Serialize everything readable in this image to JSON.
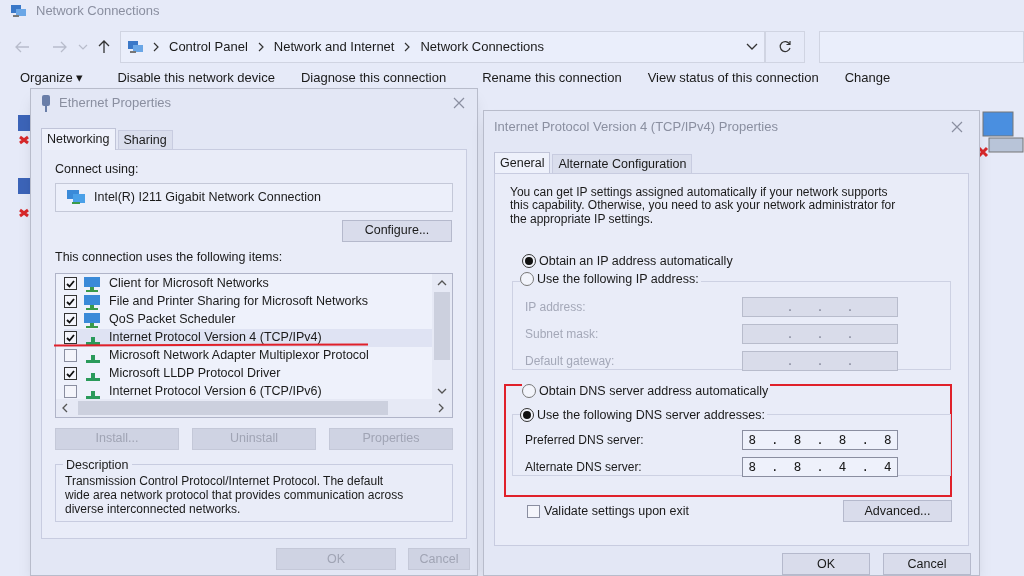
{
  "explorer": {
    "title": "Network Connections",
    "breadcrumb": [
      "Control Panel",
      "Network and Internet",
      "Network Connections"
    ],
    "toolbar": [
      "Organize ▾",
      "Disable this network device",
      "Diagnose this connection",
      "Rename this connection",
      "View status of this connection",
      "Change"
    ]
  },
  "ethernet_dialog": {
    "title": "Ethernet Properties",
    "tabs": [
      {
        "label": "Networking",
        "selected": true
      },
      {
        "label": "Sharing",
        "selected": false
      }
    ],
    "connect_using_label": "Connect using:",
    "adapter": "Intel(R) I211 Gigabit Network Connection",
    "configure_button": "Configure...",
    "items_label": "This connection uses the following items:",
    "items": [
      {
        "label": "Client for Microsoft Networks",
        "checked": true,
        "selected": false,
        "kind": "client"
      },
      {
        "label": "File and Printer Sharing for Microsoft Networks",
        "checked": true,
        "selected": false,
        "kind": "client"
      },
      {
        "label": "QoS Packet Scheduler",
        "checked": true,
        "selected": false,
        "kind": "client"
      },
      {
        "label": "Internet Protocol Version 4 (TCP/IPv4)",
        "checked": true,
        "selected": true,
        "kind": "protocol"
      },
      {
        "label": "Microsoft Network Adapter Multiplexor Protocol",
        "checked": false,
        "selected": false,
        "kind": "protocol"
      },
      {
        "label": "Microsoft LLDP Protocol Driver",
        "checked": true,
        "selected": false,
        "kind": "protocol"
      },
      {
        "label": "Internet Protocol Version 6 (TCP/IPv6)",
        "checked": false,
        "selected": false,
        "kind": "protocol"
      }
    ],
    "item_buttons": [
      {
        "label": "Install...",
        "disabled": true
      },
      {
        "label": "Uninstall",
        "disabled": true
      },
      {
        "label": "Properties",
        "disabled": true
      }
    ],
    "description_label": "Description",
    "description": "Transmission Control Protocol/Internet Protocol. The default wide area network protocol that provides communication across diverse interconnected networks.",
    "buttons": [
      {
        "label": "OK",
        "disabled": true
      },
      {
        "label": "Cancel",
        "disabled": true
      }
    ]
  },
  "tcp_dialog": {
    "title": "Internet Protocol Version 4 (TCP/IPv4) Properties",
    "tabs": [
      {
        "label": "General",
        "selected": true
      },
      {
        "label": "Alternate Configuration",
        "selected": false
      }
    ],
    "intro": "You can get IP settings assigned automatically if your network supports this capability. Otherwise, you need to ask your network administrator for the appropriate IP settings.",
    "ip_options": [
      {
        "label": "Obtain an IP address automatically",
        "selected": true
      },
      {
        "label": "Use the following IP address:",
        "selected": false
      }
    ],
    "ip_fields": [
      {
        "label": "IP address:",
        "value": ".   .   .",
        "disabled": true
      },
      {
        "label": "Subnet mask:",
        "value": ".   .   .",
        "disabled": true
      },
      {
        "label": "Default gateway:",
        "value": ".   .   .",
        "disabled": true
      }
    ],
    "dns_options": [
      {
        "label": "Obtain DNS server address automatically",
        "selected": false
      },
      {
        "label": "Use the following DNS server addresses:",
        "selected": true
      }
    ],
    "dns_fields": [
      {
        "label": "Preferred DNS server:",
        "value": "8  .  8  .  8  .  8",
        "disabled": false
      },
      {
        "label": "Alternate DNS server:",
        "value": "8  .  8  .  4  .  4",
        "disabled": false
      }
    ],
    "validate": {
      "label": "Validate settings upon exit",
      "checked": false
    },
    "advanced_button": "Advanced...",
    "buttons": [
      {
        "label": "OK"
      },
      {
        "label": "Cancel"
      }
    ]
  }
}
